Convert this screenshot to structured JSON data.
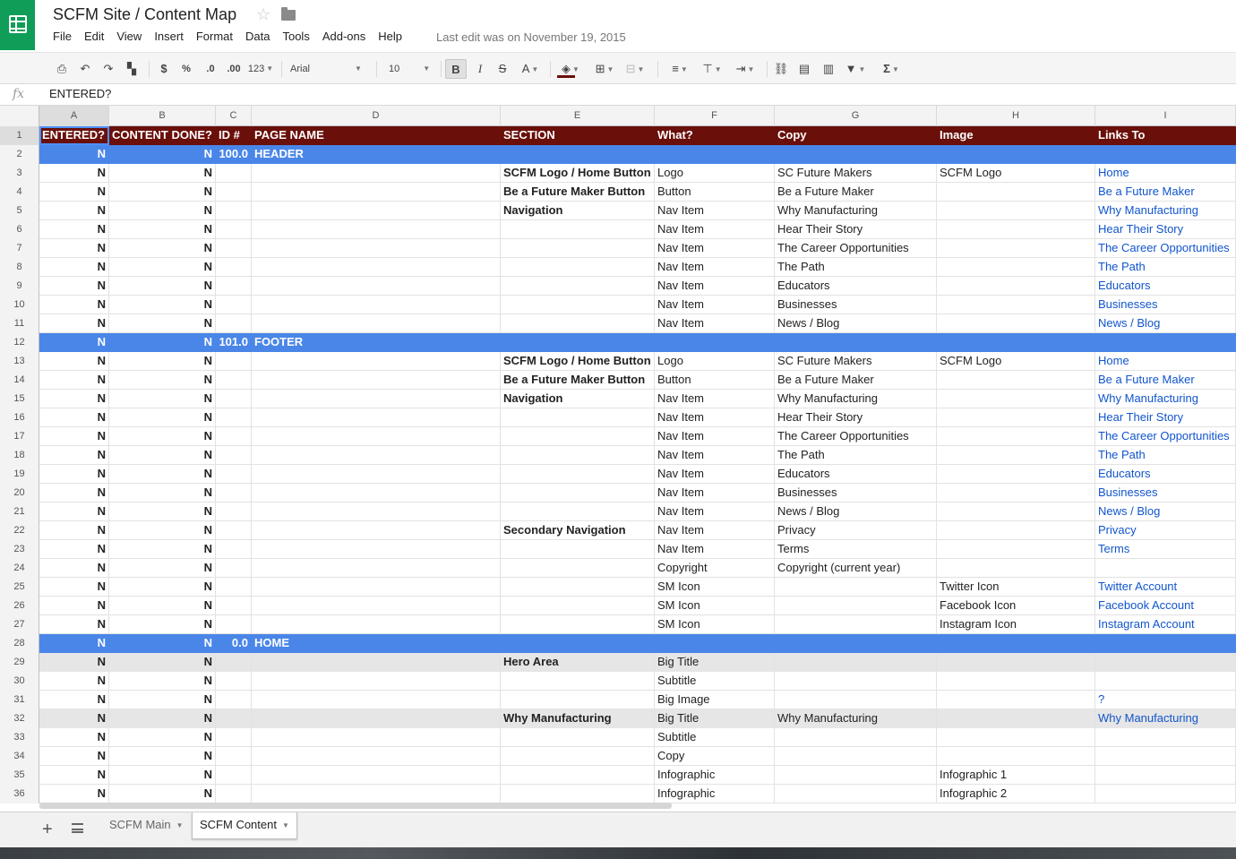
{
  "app": {
    "title": "SCFM Site / Content Map",
    "last_edit": "Last edit was on November 19, 2015"
  },
  "menu": [
    "File",
    "Edit",
    "View",
    "Insert",
    "Format",
    "Data",
    "Tools",
    "Add-ons",
    "Help"
  ],
  "toolbar": {
    "currency": "$",
    "percent": "%",
    "dec_less": ".0",
    "dec_more": ".00",
    "more_formats": "123",
    "font": "Arial",
    "font_size": "10",
    "bold": "B",
    "italic": "I",
    "strike": "S",
    "text_color": "A",
    "functions": "Σ"
  },
  "formula_bar": {
    "fx": "fx",
    "value": "ENTERED?"
  },
  "columns": [
    "A",
    "B",
    "C",
    "D",
    "E",
    "F",
    "G",
    "H",
    "I"
  ],
  "rows": [
    {
      "n": "1",
      "type": "hdr",
      "cells": [
        "ENTERED?",
        "CONTENT DONE?",
        "ID #",
        "PAGE NAME",
        "SECTION",
        "What?",
        "Copy",
        "Image",
        "Links To"
      ]
    },
    {
      "n": "2",
      "type": "section",
      "cells": [
        "N",
        "N",
        "100.0",
        "HEADER",
        "",
        "",
        "",
        "",
        ""
      ]
    },
    {
      "n": "3",
      "type": "",
      "cells": [
        "N",
        "N",
        "",
        "",
        "SCFM Logo / Home Button",
        "Logo",
        "SC Future Makers",
        "SCFM Logo",
        "Home"
      ]
    },
    {
      "n": "4",
      "type": "",
      "cells": [
        "N",
        "N",
        "",
        "",
        "Be a Future Maker Button",
        "Button",
        "Be a Future Maker",
        "",
        "Be a Future Maker"
      ]
    },
    {
      "n": "5",
      "type": "",
      "cells": [
        "N",
        "N",
        "",
        "",
        "Navigation",
        "Nav Item",
        "Why Manufacturing",
        "",
        "Why Manufacturing"
      ]
    },
    {
      "n": "6",
      "type": "",
      "cells": [
        "N",
        "N",
        "",
        "",
        "",
        "Nav Item",
        "Hear Their Story",
        "",
        "Hear Their Story"
      ]
    },
    {
      "n": "7",
      "type": "",
      "cells": [
        "N",
        "N",
        "",
        "",
        "",
        "Nav Item",
        "The Career Opportunities",
        "",
        "The Career Opportunities"
      ]
    },
    {
      "n": "8",
      "type": "",
      "cells": [
        "N",
        "N",
        "",
        "",
        "",
        "Nav Item",
        "The Path",
        "",
        "The Path"
      ]
    },
    {
      "n": "9",
      "type": "",
      "cells": [
        "N",
        "N",
        "",
        "",
        "",
        "Nav Item",
        "Educators",
        "",
        "Educators"
      ]
    },
    {
      "n": "10",
      "type": "",
      "cells": [
        "N",
        "N",
        "",
        "",
        "",
        "Nav Item",
        "Businesses",
        "",
        "Businesses"
      ]
    },
    {
      "n": "11",
      "type": "",
      "cells": [
        "N",
        "N",
        "",
        "",
        "",
        "Nav Item",
        "News / Blog",
        "",
        "News / Blog"
      ]
    },
    {
      "n": "12",
      "type": "section",
      "cells": [
        "N",
        "N",
        "101.0",
        "FOOTER",
        "",
        "",
        "",
        "",
        ""
      ]
    },
    {
      "n": "13",
      "type": "",
      "cells": [
        "N",
        "N",
        "",
        "",
        "SCFM Logo / Home Button",
        "Logo",
        "SC Future Makers",
        "SCFM Logo",
        "Home"
      ]
    },
    {
      "n": "14",
      "type": "",
      "cells": [
        "N",
        "N",
        "",
        "",
        "Be a Future Maker Button",
        "Button",
        "Be a Future Maker",
        "",
        "Be a Future Maker"
      ]
    },
    {
      "n": "15",
      "type": "",
      "cells": [
        "N",
        "N",
        "",
        "",
        "Navigation",
        "Nav Item",
        "Why Manufacturing",
        "",
        "Why Manufacturing"
      ]
    },
    {
      "n": "16",
      "type": "",
      "cells": [
        "N",
        "N",
        "",
        "",
        "",
        "Nav Item",
        "Hear Their Story",
        "",
        "Hear Their Story"
      ]
    },
    {
      "n": "17",
      "type": "",
      "cells": [
        "N",
        "N",
        "",
        "",
        "",
        "Nav Item",
        "The Career Opportunities",
        "",
        "The Career Opportunities"
      ]
    },
    {
      "n": "18",
      "type": "",
      "cells": [
        "N",
        "N",
        "",
        "",
        "",
        "Nav Item",
        "The Path",
        "",
        "The Path"
      ]
    },
    {
      "n": "19",
      "type": "",
      "cells": [
        "N",
        "N",
        "",
        "",
        "",
        "Nav Item",
        "Educators",
        "",
        "Educators"
      ]
    },
    {
      "n": "20",
      "type": "",
      "cells": [
        "N",
        "N",
        "",
        "",
        "",
        "Nav Item",
        "Businesses",
        "",
        "Businesses"
      ]
    },
    {
      "n": "21",
      "type": "",
      "cells": [
        "N",
        "N",
        "",
        "",
        "",
        "Nav Item",
        "News / Blog",
        "",
        "News / Blog"
      ]
    },
    {
      "n": "22",
      "type": "",
      "cells": [
        "N",
        "N",
        "",
        "",
        "Secondary Navigation",
        "Nav Item",
        "Privacy",
        "",
        "Privacy"
      ]
    },
    {
      "n": "23",
      "type": "",
      "cells": [
        "N",
        "N",
        "",
        "",
        "",
        "Nav Item",
        "Terms",
        "",
        "Terms"
      ]
    },
    {
      "n": "24",
      "type": "",
      "cells": [
        "N",
        "N",
        "",
        "",
        "",
        "Copyright",
        "Copyright (current year)",
        "",
        ""
      ]
    },
    {
      "n": "25",
      "type": "",
      "cells": [
        "N",
        "N",
        "",
        "",
        "",
        "SM Icon",
        "",
        "Twitter Icon",
        "Twitter Account"
      ]
    },
    {
      "n": "26",
      "type": "",
      "cells": [
        "N",
        "N",
        "",
        "",
        "",
        "SM Icon",
        "",
        "Facebook Icon",
        "Facebook Account"
      ]
    },
    {
      "n": "27",
      "type": "",
      "cells": [
        "N",
        "N",
        "",
        "",
        "",
        "SM Icon",
        "",
        "Instagram Icon",
        "Instagram Account"
      ]
    },
    {
      "n": "28",
      "type": "section",
      "cells": [
        "N",
        "N",
        "0.0",
        "HOME",
        "",
        "",
        "",
        "",
        ""
      ]
    },
    {
      "n": "29",
      "type": "shade",
      "cells": [
        "N",
        "N",
        "",
        "",
        "Hero Area",
        "Big Title",
        "",
        "",
        ""
      ]
    },
    {
      "n": "30",
      "type": "",
      "cells": [
        "N",
        "N",
        "",
        "",
        "",
        "Subtitle",
        "",
        "",
        ""
      ]
    },
    {
      "n": "31",
      "type": "",
      "cells": [
        "N",
        "N",
        "",
        "",
        "",
        "Big Image",
        "",
        "",
        "?"
      ]
    },
    {
      "n": "32",
      "type": "shade",
      "cells": [
        "N",
        "N",
        "",
        "",
        "Why Manufacturing",
        "Big Title",
        "Why Manufacturing",
        "",
        "Why Manufacturing"
      ]
    },
    {
      "n": "33",
      "type": "",
      "cells": [
        "N",
        "N",
        "",
        "",
        "",
        "Subtitle",
        "",
        "",
        ""
      ]
    },
    {
      "n": "34",
      "type": "",
      "cells": [
        "N",
        "N",
        "",
        "",
        "",
        "Copy",
        "",
        "",
        ""
      ]
    },
    {
      "n": "35",
      "type": "",
      "cells": [
        "N",
        "N",
        "",
        "",
        "",
        "Infographic",
        "",
        "Infographic 1",
        ""
      ]
    },
    {
      "n": "36",
      "type": "",
      "cells": [
        "N",
        "N",
        "",
        "",
        "",
        "Infographic",
        "",
        "Infographic 2",
        ""
      ]
    }
  ],
  "sheets": [
    {
      "label": "SCFM Main",
      "active": false
    },
    {
      "label": "SCFM Content",
      "active": true
    }
  ],
  "colors": {
    "header_row": "#6a0f0a",
    "section_row": "#4a86e8",
    "link": "#1155cc",
    "brand": "#0f9d58"
  }
}
